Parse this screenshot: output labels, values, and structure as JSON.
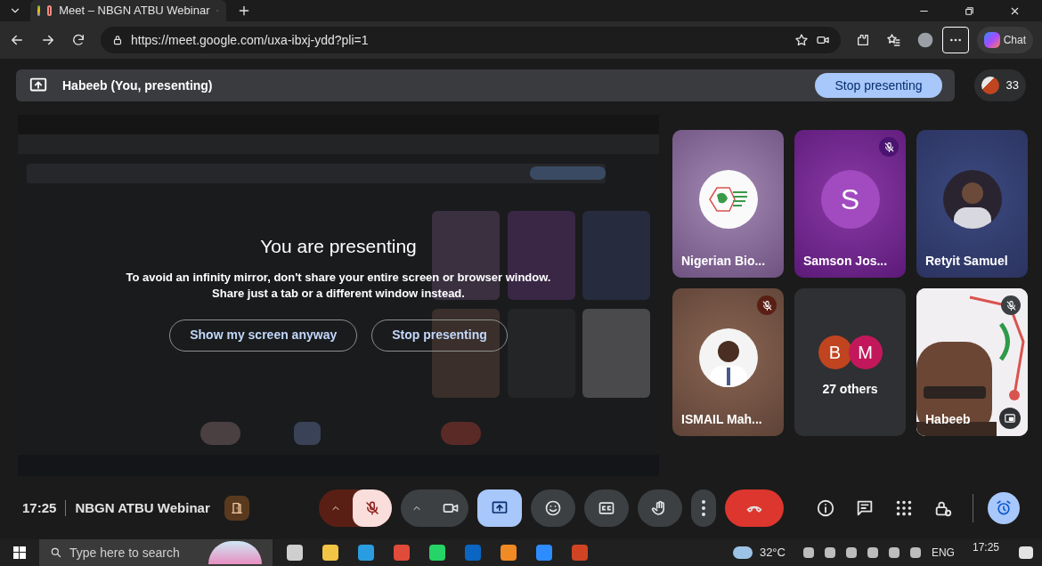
{
  "browser": {
    "tab_title": "Meet – NBGN ATBU Webinar",
    "url": "https://meet.google.com/uxa-ibxj-ydd?pli=1",
    "chat_button": "Chat"
  },
  "presenting_bar": {
    "label": "Habeeb (You, presenting)",
    "stop_button": "Stop presenting",
    "participant_count": "33"
  },
  "presentation": {
    "kind": "picture",
    "title": "You are presenting",
    "lines": [
      "To avoid an infinity mirror, don't share your entire screen or browser window.",
      "Share just a tab or a different window instead."
    ],
    "buttons": [
      "Show my screen anyway",
      "Stop presenting"
    ]
  },
  "tiles": [
    {
      "kind": "logo",
      "name": "Nigerian Bio...",
      "muted": false
    },
    {
      "kind": "letter",
      "name": "Samson Jos...",
      "letter": "S",
      "muted": true
    },
    {
      "name": "Retyit Samuel",
      "muted": false
    },
    {
      "name": "ISMAIL Mah...",
      "muted": true
    },
    {
      "kind": "others",
      "name": "27 others",
      "avatars": [
        {
          "letter": "B",
          "color": "#c0441f"
        },
        {
          "letter": "M",
          "color": "#c2185b"
        }
      ]
    },
    {
      "kind": "camera",
      "name": "Habeeb",
      "muted": true
    }
  ],
  "controls": {
    "time": "17:25",
    "meeting_name": "NBGN ATBU Webinar",
    "mic_muted": true,
    "screen_sharing": true
  },
  "taskbar": {
    "search_placeholder": "Type here to search",
    "weather": "32°C",
    "language": "ENG",
    "time": "17:25"
  }
}
